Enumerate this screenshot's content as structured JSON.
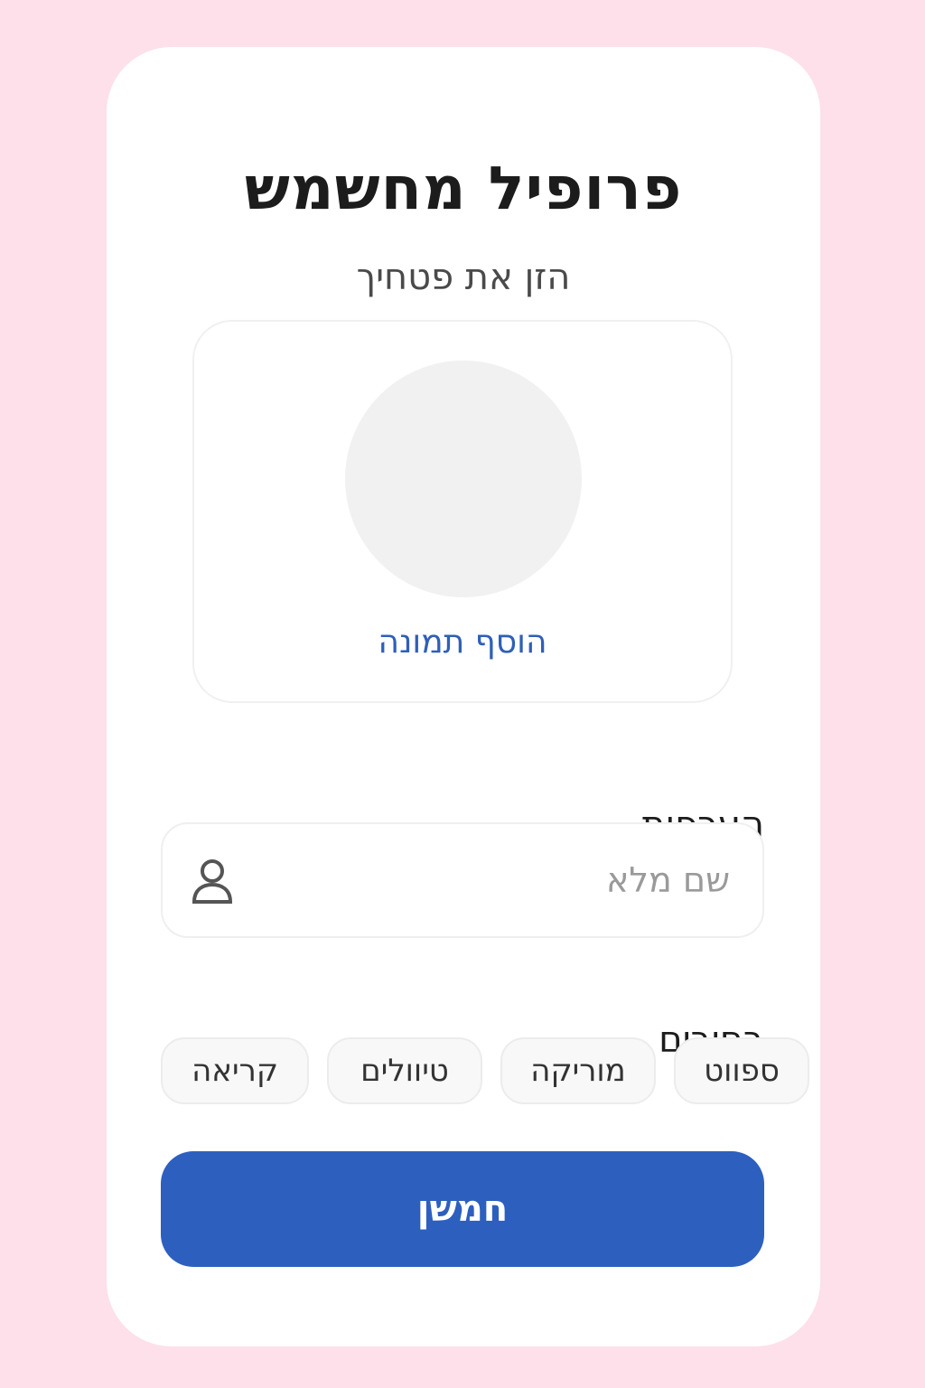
{
  "colors": {
    "background": "#fde0ea",
    "card": "#ffffff",
    "accent": "#2d5fbf",
    "link": "#2f5fb8"
  },
  "header": {
    "title": "פרופיל מחשמש",
    "subtitle": "הזן את פטחיך"
  },
  "photo": {
    "add_label": "הוסף תמונה"
  },
  "preferences": {
    "label": "הערפות",
    "name_field": {
      "placeholder": "שם מלא",
      "value": "",
      "icon": "user-icon"
    }
  },
  "hobbies": {
    "label": "בחיבים",
    "chips": [
      "ספווט",
      "מוריקה",
      "טיוולים",
      "קריאה"
    ]
  },
  "actions": {
    "save_label": "חמשן"
  }
}
